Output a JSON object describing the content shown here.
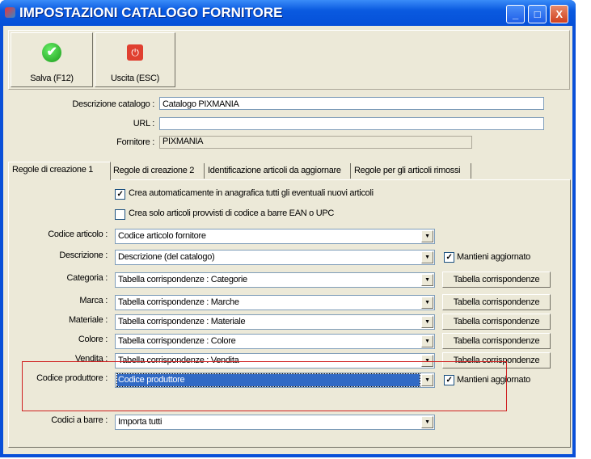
{
  "window": {
    "title": "IMPOSTAZIONI CATALOGO FORNITORE",
    "minimize": "_",
    "maximize": "□",
    "close": "X"
  },
  "toolbar": {
    "save_label": "Salva (F12)",
    "exit_label": "Uscita (ESC)",
    "save_icon": "check-icon",
    "exit_icon": "power-icon"
  },
  "form": {
    "descrizione_label": "Descrizione catalogo :",
    "descrizione_value": "Catalogo PIXMANIA",
    "url_label": "URL :",
    "url_value": "",
    "fornitore_label": "Fornitore :",
    "fornitore_value": "PIXMANIA"
  },
  "tabs": [
    {
      "label": "Regole di creazione 1",
      "active": true
    },
    {
      "label": "Regole di creazione 2"
    },
    {
      "label": "Identificazione articoli da aggiornare"
    },
    {
      "label": "Regole per gli articoli rimossi"
    }
  ],
  "checkboxes": [
    {
      "label": "Crea automaticamente in anagrafica tutti gli eventuali nuovi articoli",
      "checked": true
    },
    {
      "label": "Crea solo articoli provvisti di codice a barre EAN o UPC",
      "checked": false
    }
  ],
  "rows": [
    {
      "label": "Codice articolo :",
      "value": "Codice articolo fornitore"
    },
    {
      "label": "Descrizione :",
      "value": "Descrizione (del catalogo)",
      "check": "Mantieni aggiornato",
      "checked": true
    },
    {
      "label": "Categoria :",
      "value": "Tabella corrispondenze : Categorie",
      "button": "Tabella corrispondenze"
    },
    {
      "label": "Marca :",
      "value": "Tabella corrispondenze : Marche",
      "button": "Tabella corrispondenze"
    },
    {
      "label": "Materiale :",
      "value": "Tabella corrispondenze : Materiale",
      "button": "Tabella corrispondenze"
    },
    {
      "label": "Colore :",
      "value": "Tabella corrispondenze : Colore",
      "button": "Tabella corrispondenze"
    },
    {
      "label": "Vendita :",
      "value": "Tabella corrispondenze : Vendita",
      "button": "Tabella corrispondenze"
    },
    {
      "label": "Codice produttore :",
      "value": "Codice produttore",
      "check": "Mantieni aggiornato",
      "checked": true,
      "selected": true
    },
    {
      "label": "Codici a barre :",
      "value": "Importa tutti"
    }
  ],
  "colors": {
    "titlebar": "#0a5ae0",
    "face": "#ece9d8",
    "selection": "#316ac5",
    "highlight_box": "#d02020"
  }
}
